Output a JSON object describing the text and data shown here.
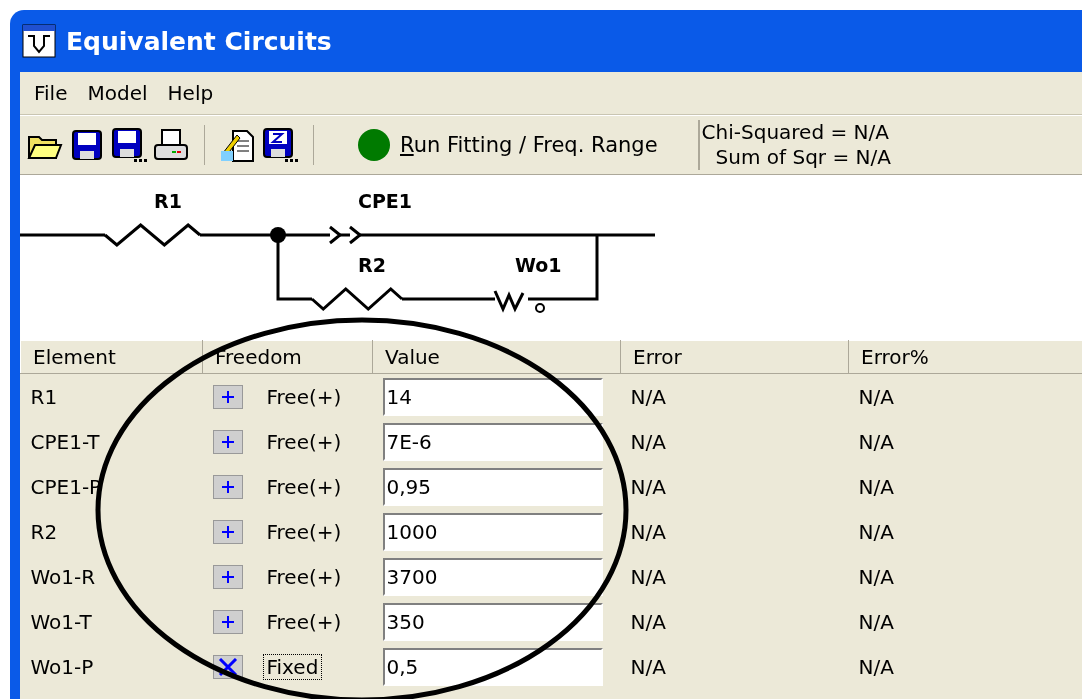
{
  "window": {
    "title": "Equivalent Circuits"
  },
  "menu": [
    "File",
    "Model",
    "Help"
  ],
  "toolbar": {
    "run_button": "Run Fitting / Freq. Range",
    "stats": [
      "Chi-Squared = N/A",
      "Sum of Sqr = N/A"
    ]
  },
  "circuit": {
    "labels": [
      "R1",
      "CPE1",
      "R2",
      "Wo1"
    ]
  },
  "table": {
    "columns": [
      "Element",
      "Freedom",
      "Value",
      "Error",
      "Error%"
    ],
    "rows": [
      {
        "element": "R1",
        "freedom": "Free(+)",
        "kind": "free",
        "focused": false,
        "value": "14",
        "error": "N/A",
        "error_pct": "N/A"
      },
      {
        "element": "CPE1-T",
        "freedom": "Free(+)",
        "kind": "free",
        "focused": false,
        "value": "7E-6",
        "error": "N/A",
        "error_pct": "N/A"
      },
      {
        "element": "CPE1-P",
        "freedom": "Free(+)",
        "kind": "free",
        "focused": false,
        "value": "0,95",
        "error": "N/A",
        "error_pct": "N/A"
      },
      {
        "element": "R2",
        "freedom": "Free(+)",
        "kind": "free",
        "focused": false,
        "value": "1000",
        "error": "N/A",
        "error_pct": "N/A"
      },
      {
        "element": "Wo1-R",
        "freedom": "Free(+)",
        "kind": "free",
        "focused": false,
        "value": "3700",
        "error": "N/A",
        "error_pct": "N/A"
      },
      {
        "element": "Wo1-T",
        "freedom": "Free(+)",
        "kind": "free",
        "focused": false,
        "value": "350",
        "error": "N/A",
        "error_pct": "N/A"
      },
      {
        "element": "Wo1-P",
        "freedom": "Fixed",
        "kind": "fixed",
        "focused": true,
        "value": "0,5",
        "error": "N/A",
        "error_pct": "N/A"
      }
    ]
  }
}
